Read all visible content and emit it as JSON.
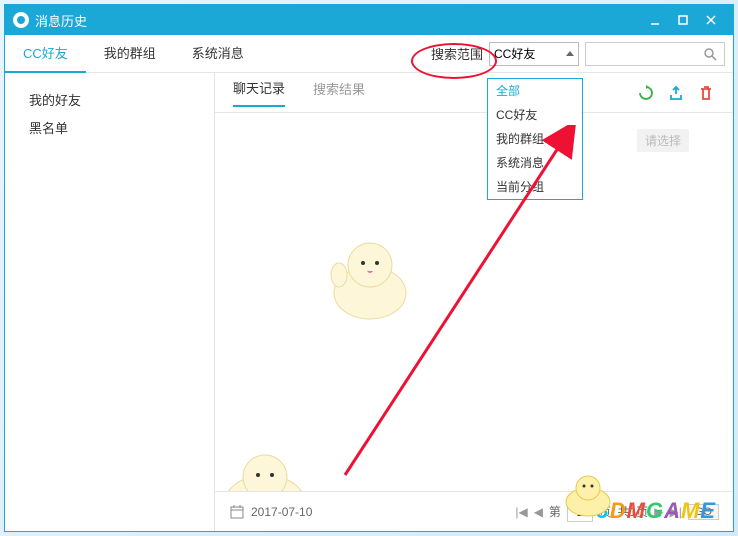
{
  "window": {
    "title": "消息历史"
  },
  "nav": {
    "items": [
      {
        "label": "CC好友",
        "active": true
      },
      {
        "label": "我的群组",
        "active": false
      },
      {
        "label": "系统消息",
        "active": false
      }
    ]
  },
  "search": {
    "scope_label": "搜索范围",
    "selected": "CC好友",
    "placeholder": "",
    "options": [
      {
        "label": "全部",
        "selected": true
      },
      {
        "label": "CC好友",
        "selected": false
      },
      {
        "label": "我的群组",
        "selected": false
      },
      {
        "label": "系统消息",
        "selected": false
      },
      {
        "label": "当前分组",
        "selected": false
      }
    ]
  },
  "sidebar": {
    "items": [
      {
        "label": "我的好友"
      },
      {
        "label": "黑名单"
      }
    ]
  },
  "tabs": {
    "items": [
      {
        "label": "聊天记录",
        "active": true
      },
      {
        "label": "搜索结果",
        "active": false
      }
    ]
  },
  "content": {
    "placeholder": "请选择"
  },
  "footer": {
    "date": "2017-07-10",
    "page_label_prefix": "第",
    "page_value": "1",
    "page_total": "页, 共1页",
    "go_label": "GO"
  },
  "watermark": "3DMGAME"
}
